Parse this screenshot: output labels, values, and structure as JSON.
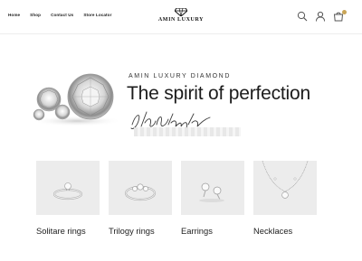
{
  "nav": {
    "items": [
      "Home",
      "Shop",
      "Contact Us",
      "Store Locator"
    ]
  },
  "brand": {
    "name": "AMIN LUXURY"
  },
  "header_icons": [
    "search-icon",
    "user-icon",
    "cart-icon"
  ],
  "hero": {
    "kicker": "AMIN LUXURY DIAMOND",
    "title": "The spirit of perfection"
  },
  "categories": [
    {
      "label": "Solitare rings"
    },
    {
      "label": "Trilogy rings"
    },
    {
      "label": "Earrings"
    },
    {
      "label": "Necklaces"
    }
  ],
  "colors": {
    "accent": "#c9a557",
    "tile_background": "#ececec"
  }
}
